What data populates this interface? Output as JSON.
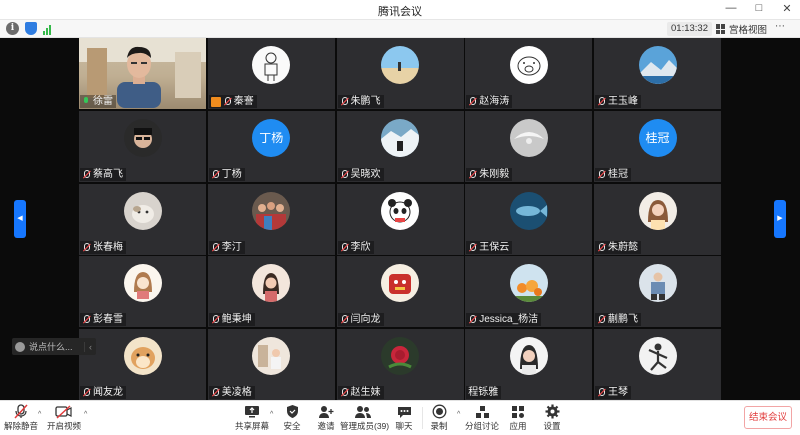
{
  "window": {
    "title": "腾讯会议",
    "controls": [
      "—",
      "□",
      "✕"
    ]
  },
  "status": {
    "timer": "01:13:32",
    "view_label": "宫格视图",
    "more": "⋯"
  },
  "participants": [
    {
      "name": "徐雷",
      "kind": "video",
      "mic": "on"
    },
    {
      "name": "秦謇",
      "kind": "drawing",
      "mic": "off",
      "host": true
    },
    {
      "name": "朱鹏飞",
      "kind": "beach",
      "mic": "off"
    },
    {
      "name": "赵海涛",
      "kind": "pig",
      "mic": "off"
    },
    {
      "name": "王玉峰",
      "kind": "mountain",
      "mic": "off"
    },
    {
      "name": "蔡高飞",
      "kind": "face-dark",
      "mic": "off"
    },
    {
      "name": "丁杨",
      "kind": "text",
      "initials": "丁杨",
      "mic": "off"
    },
    {
      "name": "吴晓欢",
      "kind": "snow",
      "mic": "off"
    },
    {
      "name": "朱刚毅",
      "kind": "bird",
      "mic": "off"
    },
    {
      "name": "桂冠",
      "kind": "text",
      "initials": "桂冠",
      "mic": "off"
    },
    {
      "name": "张春梅",
      "kind": "cat",
      "mic": "off"
    },
    {
      "name": "李汀",
      "kind": "crowd",
      "mic": "off"
    },
    {
      "name": "李欣",
      "kind": "panda",
      "mic": "off"
    },
    {
      "name": "王保云",
      "kind": "fish",
      "mic": "off"
    },
    {
      "name": "朱蔚懿",
      "kind": "girl",
      "mic": "off"
    },
    {
      "name": "彭春雪",
      "kind": "cartoon",
      "mic": "off"
    },
    {
      "name": "鲍秉坤",
      "kind": "woman",
      "mic": "off"
    },
    {
      "name": "闫向龙",
      "kind": "red-cartoon",
      "mic": "off"
    },
    {
      "name": "Jessica_杨洁",
      "kind": "flowers",
      "mic": "off"
    },
    {
      "name": "蒯鹏飞",
      "kind": "man-sit",
      "mic": "off"
    },
    {
      "name": "闻友龙",
      "kind": "hamster",
      "mic": "off"
    },
    {
      "name": "美凌格",
      "kind": "room",
      "mic": "off"
    },
    {
      "name": "赵生妹",
      "kind": "rose",
      "mic": "off"
    },
    {
      "name": "程铄雅",
      "kind": "woman2",
      "mic": "none"
    },
    {
      "name": "王琴",
      "kind": "dancer",
      "mic": "off"
    }
  ],
  "chat": {
    "placeholder": "说点什么..."
  },
  "toolbar": {
    "unmute": "解除静音",
    "start_video": "开启视频",
    "share_screen": "共享屏幕",
    "security": "安全",
    "invite": "邀请",
    "manage_members": "管理成员(39)",
    "chat": "聊天",
    "record": "录制",
    "breakout": "分组讨论",
    "apps": "应用",
    "settings": "设置",
    "end_meeting": "结束会议"
  },
  "colors": {
    "accent": "#1677ff",
    "end": "#e23c3c",
    "host_badge": "#f08c1e",
    "text_avatar": "#1f8cf2"
  }
}
